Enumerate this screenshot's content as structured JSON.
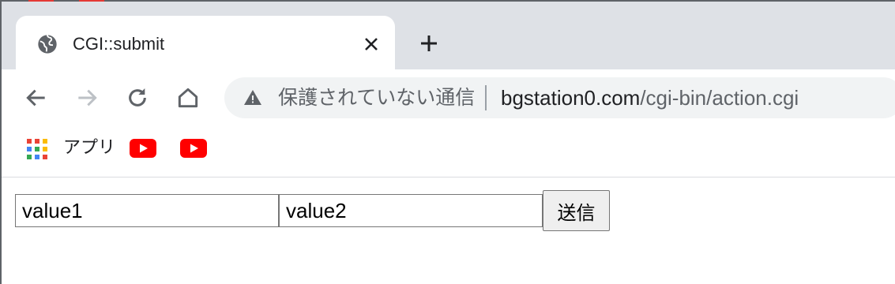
{
  "tab": {
    "title": "CGI::submit"
  },
  "address_bar": {
    "security_label": "保護されていない通信",
    "url_host": "bgstation0.com",
    "url_path": "/cgi-bin/action.cgi"
  },
  "bookmarks": {
    "apps_label": "アプリ",
    "items": [
      "youtube-icon",
      "youtube-icon"
    ]
  },
  "form": {
    "field1_value": "value1",
    "field2_value": "value2",
    "submit_label": "送信"
  },
  "colors": {
    "tabstrip_bg": "#dee1e6",
    "omnibox_bg": "#f1f3f4",
    "youtube_red": "#ff0000"
  }
}
